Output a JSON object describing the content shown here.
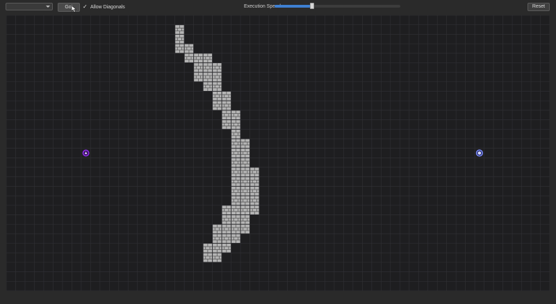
{
  "toolbar": {
    "algorithm_select": {
      "value": ""
    },
    "go_label": "Go!",
    "allow_diagonals": {
      "label": "Allow Diagonals",
      "checked": true
    },
    "execution_speed": {
      "label": "Execution Speed:",
      "value": 0.3
    },
    "reset_label": "Reset"
  },
  "grid": {
    "cols": 58,
    "rows": 29,
    "start": {
      "col": 8,
      "row": 14
    },
    "goal": {
      "col": 50,
      "row": 14
    },
    "walls": [
      [
        18,
        1
      ],
      [
        18,
        2
      ],
      [
        18,
        3
      ],
      [
        19,
        3
      ],
      [
        19,
        4
      ],
      [
        20,
        4
      ],
      [
        21,
        4
      ],
      [
        20,
        5
      ],
      [
        21,
        5
      ],
      [
        22,
        5
      ],
      [
        20,
        6
      ],
      [
        21,
        6
      ],
      [
        22,
        6
      ],
      [
        21,
        7
      ],
      [
        22,
        7
      ],
      [
        22,
        8
      ],
      [
        23,
        8
      ],
      [
        22,
        9
      ],
      [
        23,
        9
      ],
      [
        23,
        10
      ],
      [
        24,
        10
      ],
      [
        23,
        11
      ],
      [
        24,
        11
      ],
      [
        24,
        12
      ],
      [
        24,
        13
      ],
      [
        25,
        13
      ],
      [
        24,
        14
      ],
      [
        25,
        14
      ],
      [
        24,
        15
      ],
      [
        25,
        15
      ],
      [
        24,
        16
      ],
      [
        25,
        16
      ],
      [
        26,
        16
      ],
      [
        24,
        17
      ],
      [
        25,
        17
      ],
      [
        26,
        17
      ],
      [
        24,
        18
      ],
      [
        25,
        18
      ],
      [
        26,
        18
      ],
      [
        24,
        19
      ],
      [
        25,
        19
      ],
      [
        26,
        19
      ],
      [
        24,
        20
      ],
      [
        25,
        20
      ],
      [
        26,
        20
      ],
      [
        23,
        20
      ],
      [
        23,
        21
      ],
      [
        24,
        21
      ],
      [
        25,
        21
      ],
      [
        22,
        22
      ],
      [
        23,
        22
      ],
      [
        24,
        22
      ],
      [
        25,
        22
      ],
      [
        22,
        23
      ],
      [
        23,
        23
      ],
      [
        24,
        23
      ],
      [
        21,
        24
      ],
      [
        22,
        24
      ],
      [
        23,
        24
      ],
      [
        21,
        25
      ],
      [
        22,
        25
      ]
    ],
    "colors": {
      "background": "#1e1e20",
      "grid_line": "#2f2f33",
      "wall": "#b4b4b4",
      "start": "#8a2be2",
      "goal": "#7b8cff"
    },
    "start_icon": "start-node-icon",
    "goal_icon": "goal-node-icon"
  }
}
